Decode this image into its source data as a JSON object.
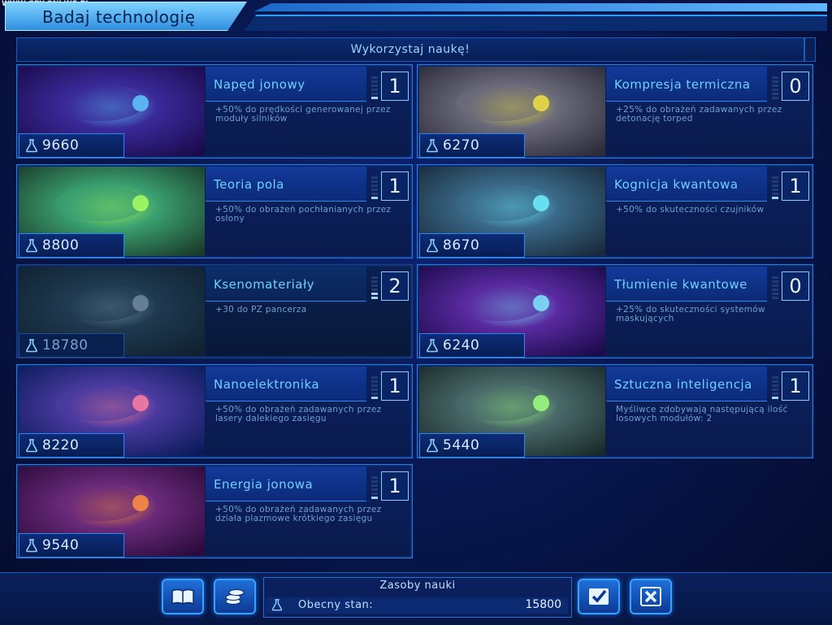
{
  "watermark": "WWW.GRY-ONLINE.PL",
  "title": "Badaj technologię",
  "subheader": "Wykorzystaj naukę!",
  "colors": {
    "accent": "#2e86f0",
    "title_bg": "#60b8ff",
    "name_text": "#6fd0ff"
  },
  "technologies": [
    {
      "name": "Napęd jonowy",
      "level": "1",
      "cost": "9660",
      "desc": "+50% do prędkości generowanej przez moduły silników",
      "locked": false,
      "max_level": 6
    },
    {
      "name": "Kompresja termiczna",
      "level": "0",
      "cost": "6270",
      "desc": "+25% do obrażeń zadawanych przez detonację torped",
      "locked": false,
      "max_level": 6
    },
    {
      "name": "Teoria pola",
      "level": "1",
      "cost": "8800",
      "desc": "+50% do obrażeń pochłanianych przez osłony",
      "locked": false,
      "max_level": 6
    },
    {
      "name": "Kognicja kwantowa",
      "level": "1",
      "cost": "8670",
      "desc": "+50% do skuteczności czujników",
      "locked": false,
      "max_level": 6
    },
    {
      "name": "Ksenomateriały",
      "level": "2",
      "cost": "18780",
      "desc": "+30 do PZ pancerza",
      "locked": true,
      "max_level": 6
    },
    {
      "name": "Tłumienie kwantowe",
      "level": "0",
      "cost": "6240",
      "desc": "+25% do skuteczności systemów maskujących",
      "locked": false,
      "max_level": 6
    },
    {
      "name": "Nanoelektronika",
      "level": "1",
      "cost": "8220",
      "desc": "+50% do obrażeń zadawanych przez lasery dalekiego zasięgu",
      "locked": false,
      "max_level": 6
    },
    {
      "name": "Sztuczna inteligencja",
      "level": "1",
      "cost": "5440",
      "desc": "Myśliwce zdobywają następującą ilość losowych modułów: 2",
      "locked": false,
      "max_level": 6
    },
    {
      "name": "Energia jonowa",
      "level": "1",
      "cost": "9540",
      "desc": "+50% do obrażeń zadawanych przez działa plazmowe krótkiego zasięgu",
      "locked": false,
      "max_level": 6
    }
  ],
  "resources": {
    "title": "Zasoby nauki",
    "label": "Obecny stan:",
    "value": "15800"
  },
  "buttons": {
    "book": "book-icon",
    "coins": "coins-icon",
    "confirm": "checkmark-icon",
    "cancel": "close-icon"
  }
}
